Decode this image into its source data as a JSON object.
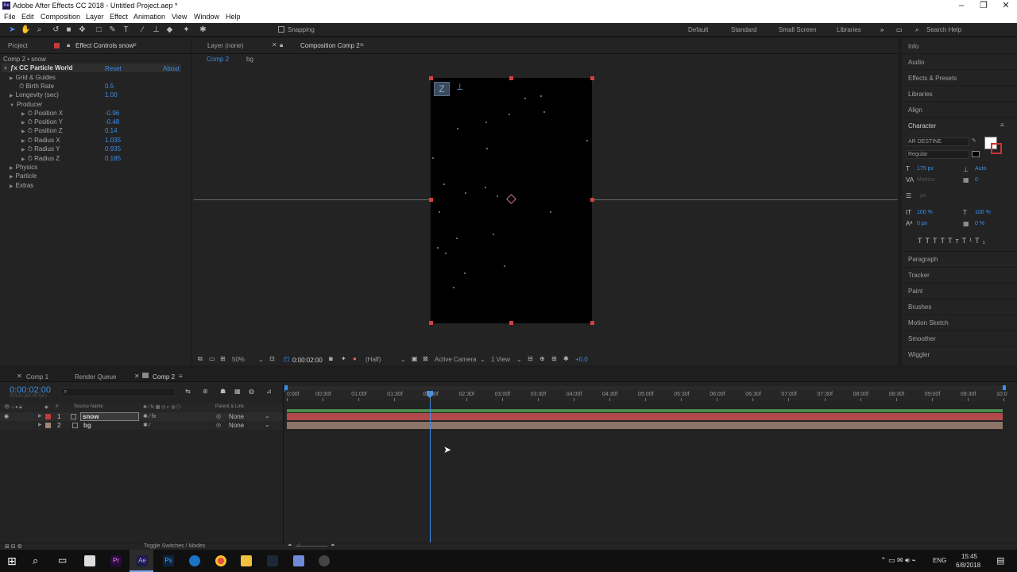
{
  "window": {
    "title": "Adobe After Effects CC 2018 - Untitled Project.aep *",
    "app_badge": "Ae"
  },
  "menu": [
    "File",
    "Edit",
    "Composition",
    "Layer",
    "Effect",
    "Animation",
    "View",
    "Window",
    "Help"
  ],
  "toolbar": {
    "snapping": "Snapping",
    "workspaces": [
      "Default",
      "Standard",
      "Small Screen",
      "Libraries"
    ],
    "search_placeholder": "Search Help"
  },
  "left_panel": {
    "tabs": [
      "Project",
      "Effect Controls snow"
    ],
    "breadcrumb": "Comp 2 • snow",
    "effect": {
      "name": "CC Particle World",
      "reset": "Reset",
      "about": "About"
    },
    "props": [
      {
        "label": "Grid & Guides",
        "value": ""
      },
      {
        "label": "Birth Rate",
        "value": "0.5"
      },
      {
        "label": "Longevity (sec)",
        "value": "1.00"
      },
      {
        "label": "Producer",
        "value": ""
      },
      {
        "label": "Position X",
        "value": "-0.96"
      },
      {
        "label": "Position Y",
        "value": "-0.48"
      },
      {
        "label": "Position Z",
        "value": "0.14"
      },
      {
        "label": "Radius X",
        "value": "1.035"
      },
      {
        "label": "Radius Y",
        "value": "0.935"
      },
      {
        "label": "Radius Z",
        "value": "0.185"
      },
      {
        "label": "Physics",
        "value": ""
      },
      {
        "label": "Particle",
        "value": ""
      },
      {
        "label": "Extras",
        "value": ""
      }
    ]
  },
  "viewer": {
    "tabs": [
      "Layer (none)",
      "Composition Comp 2"
    ],
    "crumbs": [
      "Comp 2",
      "bg"
    ],
    "bar": {
      "zoom": "50%",
      "time": "0:00:02:00",
      "resolution": "(Half)",
      "camera": "Active Camera",
      "views": "1 View",
      "exposure": "+0.0"
    }
  },
  "right_panel": {
    "items": [
      "Info",
      "Audio",
      "Effects & Presets",
      "Libraries",
      "Align"
    ],
    "character": {
      "title": "Character",
      "font": "AR DESTINE",
      "style": "Regular",
      "size": "175 px",
      "leading": "Auto",
      "kerning": "Metrics",
      "tracking": "0",
      "stroke": "- px",
      "vscale": "100 %",
      "hscale": "100 %",
      "baseline": "0 px",
      "tsume": "0 %",
      "styles": [
        "T",
        "T",
        "TT",
        "Tт",
        "T¹",
        "T₁"
      ]
    },
    "lower_items": [
      "Paragraph",
      "Tracker",
      "Paint",
      "Brushes",
      "Motion Sketch",
      "Smoother",
      "Wiggler"
    ]
  },
  "timeline": {
    "tabs": [
      "Comp 1",
      "Render Queue",
      "Comp 2"
    ],
    "timecode": "0:00:02:00",
    "frames": "00120 (60.00 fps)",
    "col_headers": {
      "num": "#",
      "source": "Source Name",
      "parent": "Parent & Link"
    },
    "layers": [
      {
        "num": "1",
        "name": "snow",
        "parent": "None"
      },
      {
        "num": "2",
        "name": "bg",
        "parent": "None"
      }
    ],
    "ruler": [
      "0:00f",
      "00:30f",
      "01:00f",
      "01:30f",
      "02:00f",
      "02:30f",
      "03:00f",
      "03:30f",
      "04:00f",
      "04:30f",
      "05:00f",
      "05:30f",
      "06:00f",
      "06:30f",
      "07:00f",
      "07:30f",
      "08:00f",
      "08:30f",
      "09:00f",
      "09:30f",
      "10:0"
    ],
    "toggle": "Toggle Switches / Modes"
  },
  "taskbar": {
    "lang": "ENG",
    "time": "15:45",
    "date": "6/8/2018"
  },
  "colors": {
    "accent": "#3d8ee8",
    "snow_bar": "#b04a4a",
    "bg_bar": "#8c7468",
    "handle": "#d34040"
  }
}
